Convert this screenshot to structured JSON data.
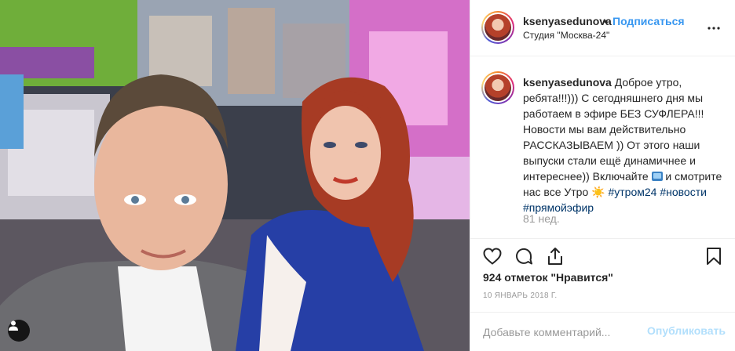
{
  "post": {
    "image": {
      "alt": "",
      "icons": {
        "tag": "user-tag-icon"
      }
    },
    "header": {
      "username": "ksenyasedunova",
      "separator": "•",
      "follow_label": "Подписаться",
      "location": "Студия \"Москва-24\"",
      "more_icon": "more-horizontal-icon"
    },
    "caption": {
      "username": "ksenyasedunova",
      "text_1": " Доброе утро, ребята!!!))) С сегодняшнего дня мы работаем в эфире БЕЗ СУФЛЕРА!!! Новости мы вам действительно РАССКАЗЫВАЕМ )) От этого наши выпуски стали ещё динамичнее и интереснее)) Включайте ",
      "text_2": " и смотрите нас все Утро ",
      "sun": "☀️",
      "hashtags": [
        "#утром24",
        "#новости",
        "#прямойэфир"
      ],
      "time_ago": "81 нед."
    },
    "actions": {
      "like_icon": "heart-icon",
      "comment_icon": "comment-icon",
      "share_icon": "share-icon",
      "save_icon": "bookmark-icon"
    },
    "likes_text": "924 отметок \"Нравится\"",
    "date": "10 ЯНВАРЬ 2018 Г.",
    "comment": {
      "placeholder": "Добавьте комментарий...",
      "publish_label": "Опубликовать"
    }
  }
}
